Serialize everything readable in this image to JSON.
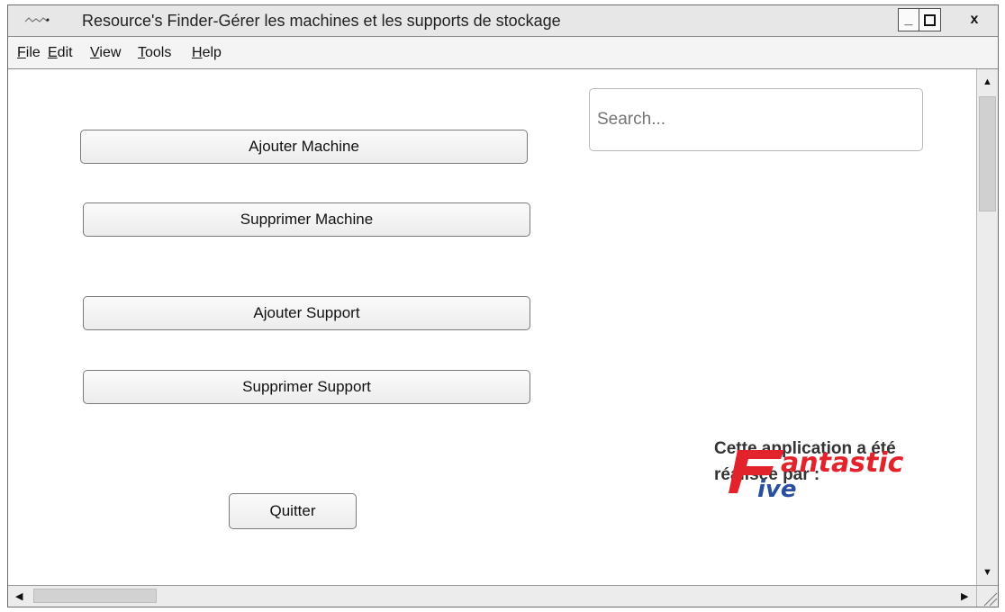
{
  "window": {
    "title_bold": "Resource's Finder",
    "title_rest": "-Gérer les machines et les supports de stockage",
    "minimize_label": "_",
    "maximize_label": "□",
    "close_label": "x"
  },
  "menu": {
    "items": [
      {
        "key": "F",
        "rest": "ile"
      },
      {
        "key": "E",
        "rest": "dit"
      },
      {
        "key": "V",
        "rest": "iew"
      },
      {
        "key": "T",
        "rest": "ools"
      },
      {
        "key": "H",
        "rest": "elp"
      }
    ]
  },
  "buttons": {
    "add_machine": "Ajouter Machine",
    "remove_machine": "Supprimer Machine",
    "add_support": "Ajouter Support",
    "remove_support": "Supprimer Support",
    "quit": "Quitter"
  },
  "search": {
    "placeholder": "Search..."
  },
  "credit": {
    "line1": "Cette application a été",
    "line2": "réalisée par :",
    "logo_text_top": "antastic",
    "logo_text_bottom": "ive",
    "logo_color": "#e2232b"
  },
  "scrollbar": {
    "up": "▲",
    "down": "▼",
    "left": "◀",
    "right": "▶"
  }
}
